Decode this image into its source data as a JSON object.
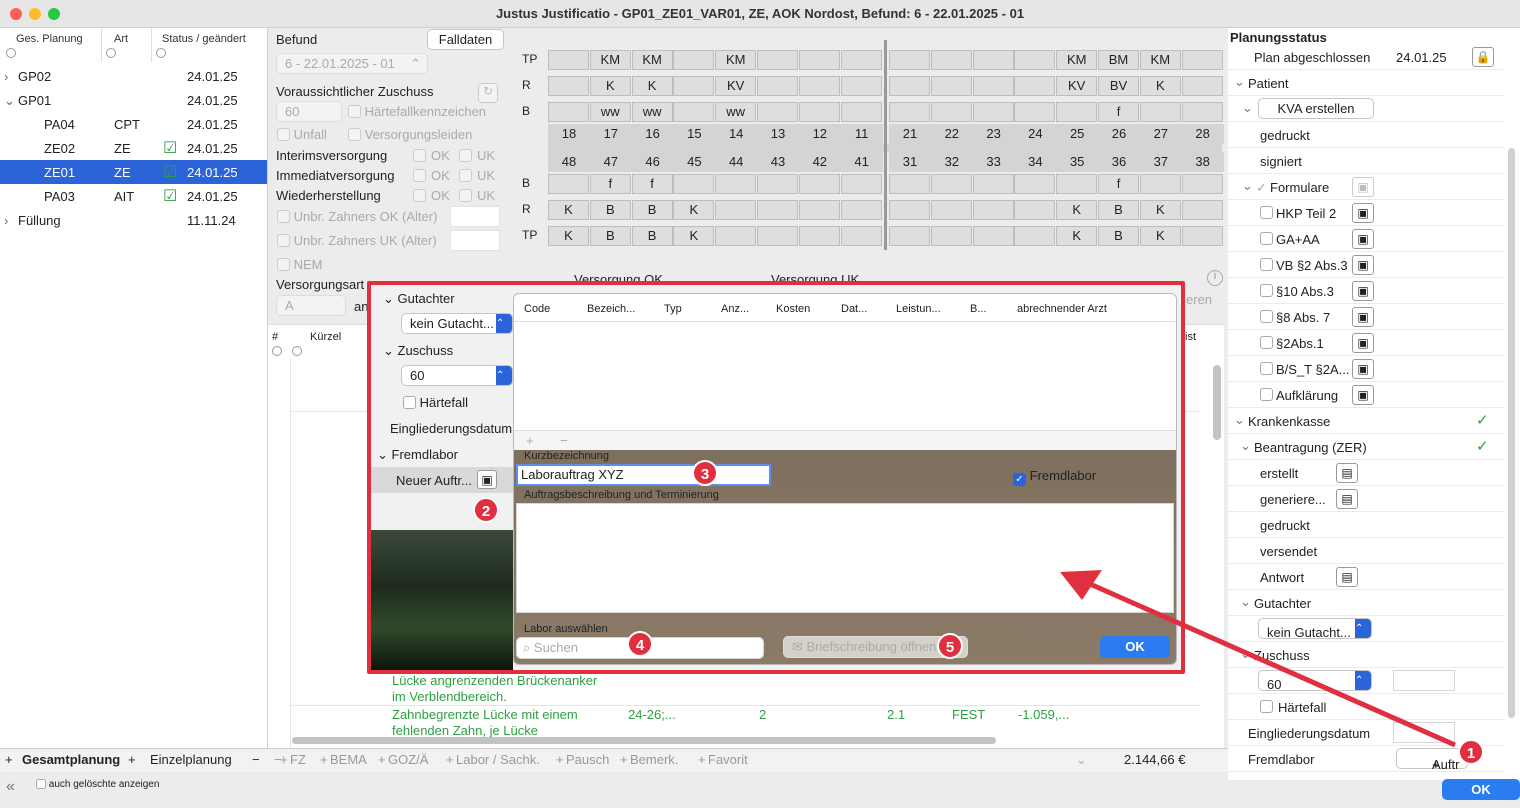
{
  "window": {
    "title": "Justus Justificatio  -  GP01_ZE01_VAR01, ZE, AOK Nordost, Befund: 6 - 22.01.2025 - 01"
  },
  "left": {
    "columns": [
      "Ges. Planung",
      "Art",
      "Status / geändert"
    ],
    "rows": [
      {
        "name": "GP02",
        "art": "",
        "date": "24.01.25",
        "chev": "›"
      },
      {
        "name": "GP01",
        "art": "",
        "date": "24.01.25",
        "chev": "⌄"
      },
      {
        "name": "PA04",
        "art": "CPT",
        "date": "24.01.25"
      },
      {
        "name": "ZE02",
        "art": "ZE",
        "date": "24.01.25",
        "icon": true
      },
      {
        "name": "ZE01",
        "art": "ZE",
        "date": "24.01.25",
        "icon": true,
        "selected": true
      },
      {
        "name": "PA03",
        "art": "AIT",
        "date": "24.01.25",
        "icon": true
      },
      {
        "name": "Füllung",
        "art": "",
        "date": "11.11.24",
        "chev": "›"
      }
    ],
    "tab_gesamt": "Gesamtplanung",
    "tab_einzel": "Einzelplanung",
    "show_deleted": "auch gelöschte anzeigen"
  },
  "befund": {
    "label": "Befund",
    "falldaten": "Falldaten",
    "select": "6 - 22.01.2025 - 01",
    "zuschuss_label": "Voraussichtlicher Zuschuss",
    "zuschuss_value": "60",
    "haertefall": "Härtefallkennzeichen",
    "unfall": "Unfall",
    "versorgungsleiden": "Versorgungsleiden",
    "interim": "Interimsversorgung",
    "immediat": "Immediatversorgung",
    "wieder": "Wiederherstellung",
    "ok": "OK",
    "uk": "UK",
    "unbr_ok": "Unbr. Zahners OK (Alter)",
    "unbr_uk": "Unbr. Zahners UK (Alter)",
    "nem": "NEM",
    "versorgungsart": "Versorgungsart",
    "versorgungsart_value": "A",
    "an": "an",
    "versorgung_ok": "Versorgung OK",
    "versorgung_uk": "Versorgung UK"
  },
  "teeth": {
    "row_labels_top": [
      "TP",
      "R",
      "B"
    ],
    "row_labels_bottom": [
      "B",
      "R",
      "TP"
    ],
    "upper_tp": [
      "",
      "KM",
      "KM",
      "",
      "KM",
      "",
      "",
      "",
      "",
      "",
      "",
      "",
      "KM",
      "BM",
      "KM",
      ""
    ],
    "upper_r": [
      "",
      "K",
      "K",
      "",
      "KV",
      "",
      "",
      "",
      "",
      "",
      "",
      "",
      "KV",
      "BV",
      "K",
      ""
    ],
    "upper_b": [
      "",
      "ww",
      "ww",
      "",
      "ww",
      "",
      "",
      "",
      "",
      "",
      "",
      "",
      "",
      "f",
      "",
      ""
    ],
    "upper_nums": [
      "18",
      "17",
      "16",
      "15",
      "14",
      "13",
      "12",
      "11",
      "21",
      "22",
      "23",
      "24",
      "25",
      "26",
      "27",
      "28"
    ],
    "lower_nums": [
      "48",
      "47",
      "46",
      "45",
      "44",
      "43",
      "42",
      "41",
      "31",
      "32",
      "33",
      "34",
      "35",
      "36",
      "37",
      "38"
    ],
    "lower_b": [
      "",
      "f",
      "f",
      "",
      "",
      "",
      "",
      "",
      "",
      "",
      "",
      "",
      "",
      "f",
      "",
      ""
    ],
    "lower_r": [
      "K",
      "B",
      "B",
      "K",
      "",
      "",
      "",
      "",
      "",
      "",
      "",
      "",
      "K",
      "B",
      "K",
      ""
    ],
    "lower_tp": [
      "K",
      "B",
      "B",
      "K",
      "",
      "",
      "",
      "",
      "",
      "",
      "",
      "",
      "K",
      "B",
      "K",
      ""
    ]
  },
  "table": {
    "hash": "#",
    "kuerzel": "Kürzel",
    "ist": "ist",
    "rows": [
      {
        "text1": "Lücke angrenzenden Brückenanker",
        "text2": "im Verblendbereich."
      },
      {
        "text1": "Zahnbegrenzte Lücke mit einem",
        "text2": "fehlenden Zahn, je Lücke",
        "teeth": "24-26;...",
        "anz": "2",
        "fact": "2.1",
        "typ": "FEST",
        "cost": "-1.059,..."
      }
    ],
    "total": "2.144,66 €"
  },
  "toolbar": {
    "items": [
      "FZ",
      "BEMA",
      "GOZ/Ä",
      "Labor / Sachk.",
      "Pausch",
      "Bemerk.",
      "Favorit"
    ]
  },
  "overlay": {
    "gutachter": "Gutachter",
    "gutachter_value": "kein Gutacht...",
    "zuschuss": "Zuschuss",
    "zuschuss_value": "60",
    "haertefall": "Härtefall",
    "eingliederung": "Eingliederungsdatum",
    "fremdlabor": "Fremdlabor",
    "neuer_auftrag": "Neuer Auftr...",
    "columns": [
      "Code",
      "Bezeich...",
      "Typ",
      "Anz...",
      "Kosten",
      "Dat...",
      "Leistun...",
      "B...",
      "abrechnender Arzt"
    ],
    "kurzbezeichnung": "Kurzbezeichnung",
    "kurz_value": "Laborauftrag XYZ",
    "fremdlabor_chk": "Fremdlabor",
    "beschreibung": "Auftragsbeschreibung und Terminierung",
    "labor": "Labor auswählen",
    "search_placeholder": "Suchen",
    "brief": "Briefschreibung öffnen",
    "ok": "OK",
    "ren": "eren"
  },
  "right": {
    "title": "Planungsstatus",
    "plan_label": "Plan abgeschlossen",
    "plan_date": "24.01.25",
    "patient": "Patient",
    "kva": "KVA erstellen",
    "gedruckt": "gedruckt",
    "signiert": "signiert",
    "formulare": "Formulare",
    "forms": [
      "HKP Teil 2",
      "GA+AA",
      "VB §2 Abs.3",
      "§10 Abs.3",
      "§8 Abs. 7",
      "§2Abs.1",
      "B/S_T §2A...",
      "Aufklärung"
    ],
    "krankenkasse": "Krankenkasse",
    "beantragung": "Beantragung (ZER)",
    "erstellt": "erstellt",
    "generiert": "generiere...",
    "gedruckt2": "gedruckt",
    "versendet": "versendet",
    "antwort": "Antwort",
    "gutachter": "Gutachter",
    "gutachter_value": "kein Gutacht...",
    "zuschuss": "Zuschuss",
    "zuschuss_value": "60",
    "haertefall": "Härtefall",
    "eingliederung": "Eingliederungsdatum",
    "fremdlabor": "Fremdlabor",
    "auftrag": "Auftr"
  },
  "ok_main": "OK",
  "badges": [
    "1",
    "2",
    "3",
    "4",
    "5"
  ],
  "colors": {
    "accent": "#2a64d8",
    "red": "#e03040",
    "green": "#2ea043"
  }
}
